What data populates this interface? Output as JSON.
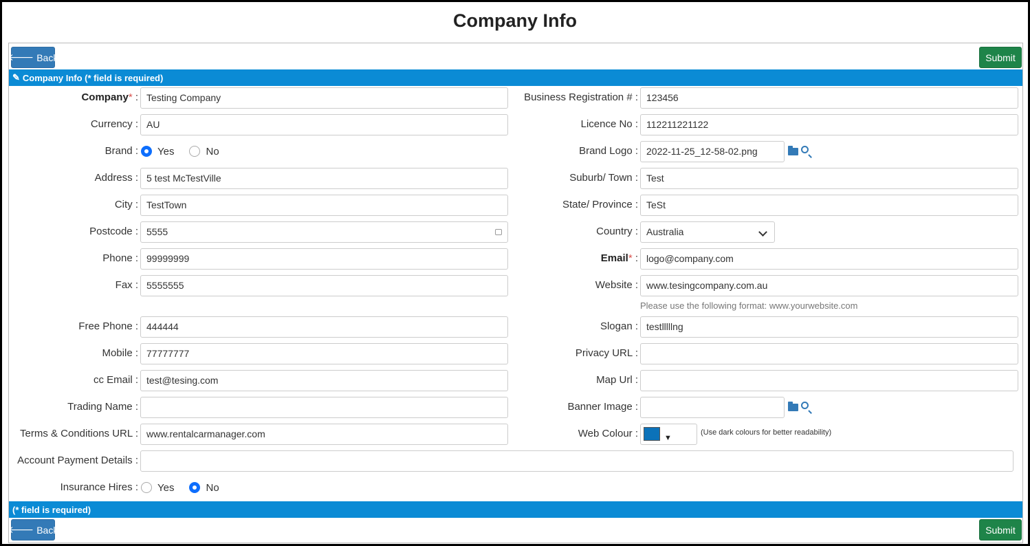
{
  "page": {
    "title": "Company Info"
  },
  "toolbar": {
    "back_label": "Back",
    "submit_label": "Submit"
  },
  "section": {
    "header": "Company Info (* field is required)",
    "footer": "(* field is required)"
  },
  "left": {
    "company": {
      "label": "Company",
      "value": "Testing Company"
    },
    "currency": {
      "label": "Currency :",
      "value": "AU"
    },
    "brand": {
      "label": "Brand :",
      "yes": "Yes",
      "no": "No",
      "selected": "Yes"
    },
    "address": {
      "label": "Address :",
      "value": "5 test McTestVille"
    },
    "city": {
      "label": "City :",
      "value": "TestTown"
    },
    "postcode": {
      "label": "Postcode :",
      "value": "5555"
    },
    "phone": {
      "label": "Phone :",
      "value": "99999999"
    },
    "fax": {
      "label": "Fax :",
      "value": "5555555"
    },
    "free_phone": {
      "label": "Free Phone :",
      "value": "444444"
    },
    "mobile": {
      "label": "Mobile :",
      "value": "77777777"
    },
    "cc_email": {
      "label": "cc Email :",
      "value": "test@tesing.com"
    },
    "trading_name": {
      "label": "Trading Name :",
      "value": ""
    },
    "terms_url": {
      "label": "Terms & Conditions URL :",
      "value": "www.rentalcarmanager.com"
    },
    "account_payment": {
      "label": "Account Payment Details :",
      "value": ""
    },
    "insurance_hires": {
      "label": "Insurance Hires :",
      "yes": "Yes",
      "no": "No",
      "selected": "No"
    }
  },
  "right": {
    "business_reg": {
      "label": "Business Registration # :",
      "value": "123456"
    },
    "licence": {
      "label": "Licence No :",
      "value": "112211221122"
    },
    "brand_logo": {
      "label": "Brand Logo :",
      "value": "2022-11-25_12-58-02.png"
    },
    "suburb": {
      "label": "Suburb/ Town :",
      "value": "Test"
    },
    "state": {
      "label": "State/ Province :",
      "value": "TeSt"
    },
    "country": {
      "label": "Country :",
      "value": "Australia"
    },
    "email": {
      "label": "Email",
      "value": "logo@company.com"
    },
    "website": {
      "label": "Website :",
      "value": "www.tesingcompany.com.au",
      "hint": "Please use the following format: www.yourwebsite.com"
    },
    "slogan": {
      "label": "Slogan :",
      "value": "testlllllng"
    },
    "privacy_url": {
      "label": "Privacy URL :",
      "value": ""
    },
    "map_url": {
      "label": "Map Url :",
      "value": ""
    },
    "banner_image": {
      "label": "Banner Image :",
      "value": ""
    },
    "web_colour": {
      "label": "Web Colour :",
      "note": "(Use dark colours for better readability)",
      "color": "#0b72b9"
    }
  },
  "colors": {
    "accent": "#0b8bd5",
    "back": "#337ab7",
    "submit": "#1e8449",
    "required": "#d9534f"
  }
}
